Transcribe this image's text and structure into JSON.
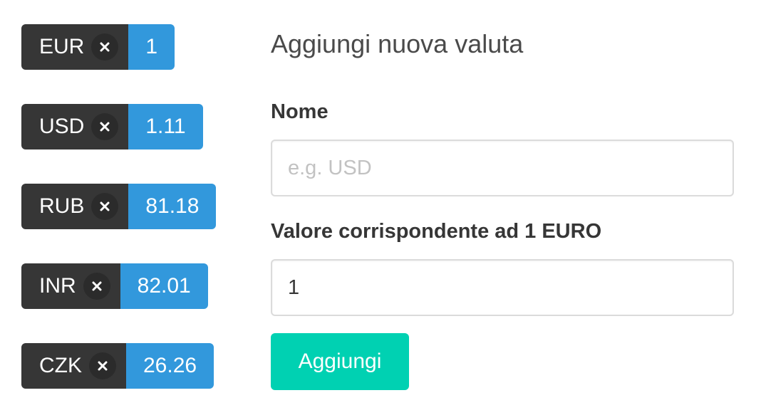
{
  "currencies": [
    {
      "code": "EUR",
      "value": "1"
    },
    {
      "code": "USD",
      "value": "1.11"
    },
    {
      "code": "RUB",
      "value": "81.18"
    },
    {
      "code": "INR",
      "value": "82.01"
    },
    {
      "code": "CZK",
      "value": "26.26"
    }
  ],
  "icons": {
    "delete": "close-icon"
  },
  "colors": {
    "tag_dark": "#363636",
    "tag_value": "#3298dc",
    "button": "#00d1b2"
  },
  "form": {
    "title": "Aggiungi nuova valuta",
    "name_label": "Nome",
    "name_placeholder": "e.g. USD",
    "name_value": "",
    "value_label": "Valore corrispondente ad 1 EURO",
    "value_value": "1",
    "submit_label": "Aggiungi"
  }
}
